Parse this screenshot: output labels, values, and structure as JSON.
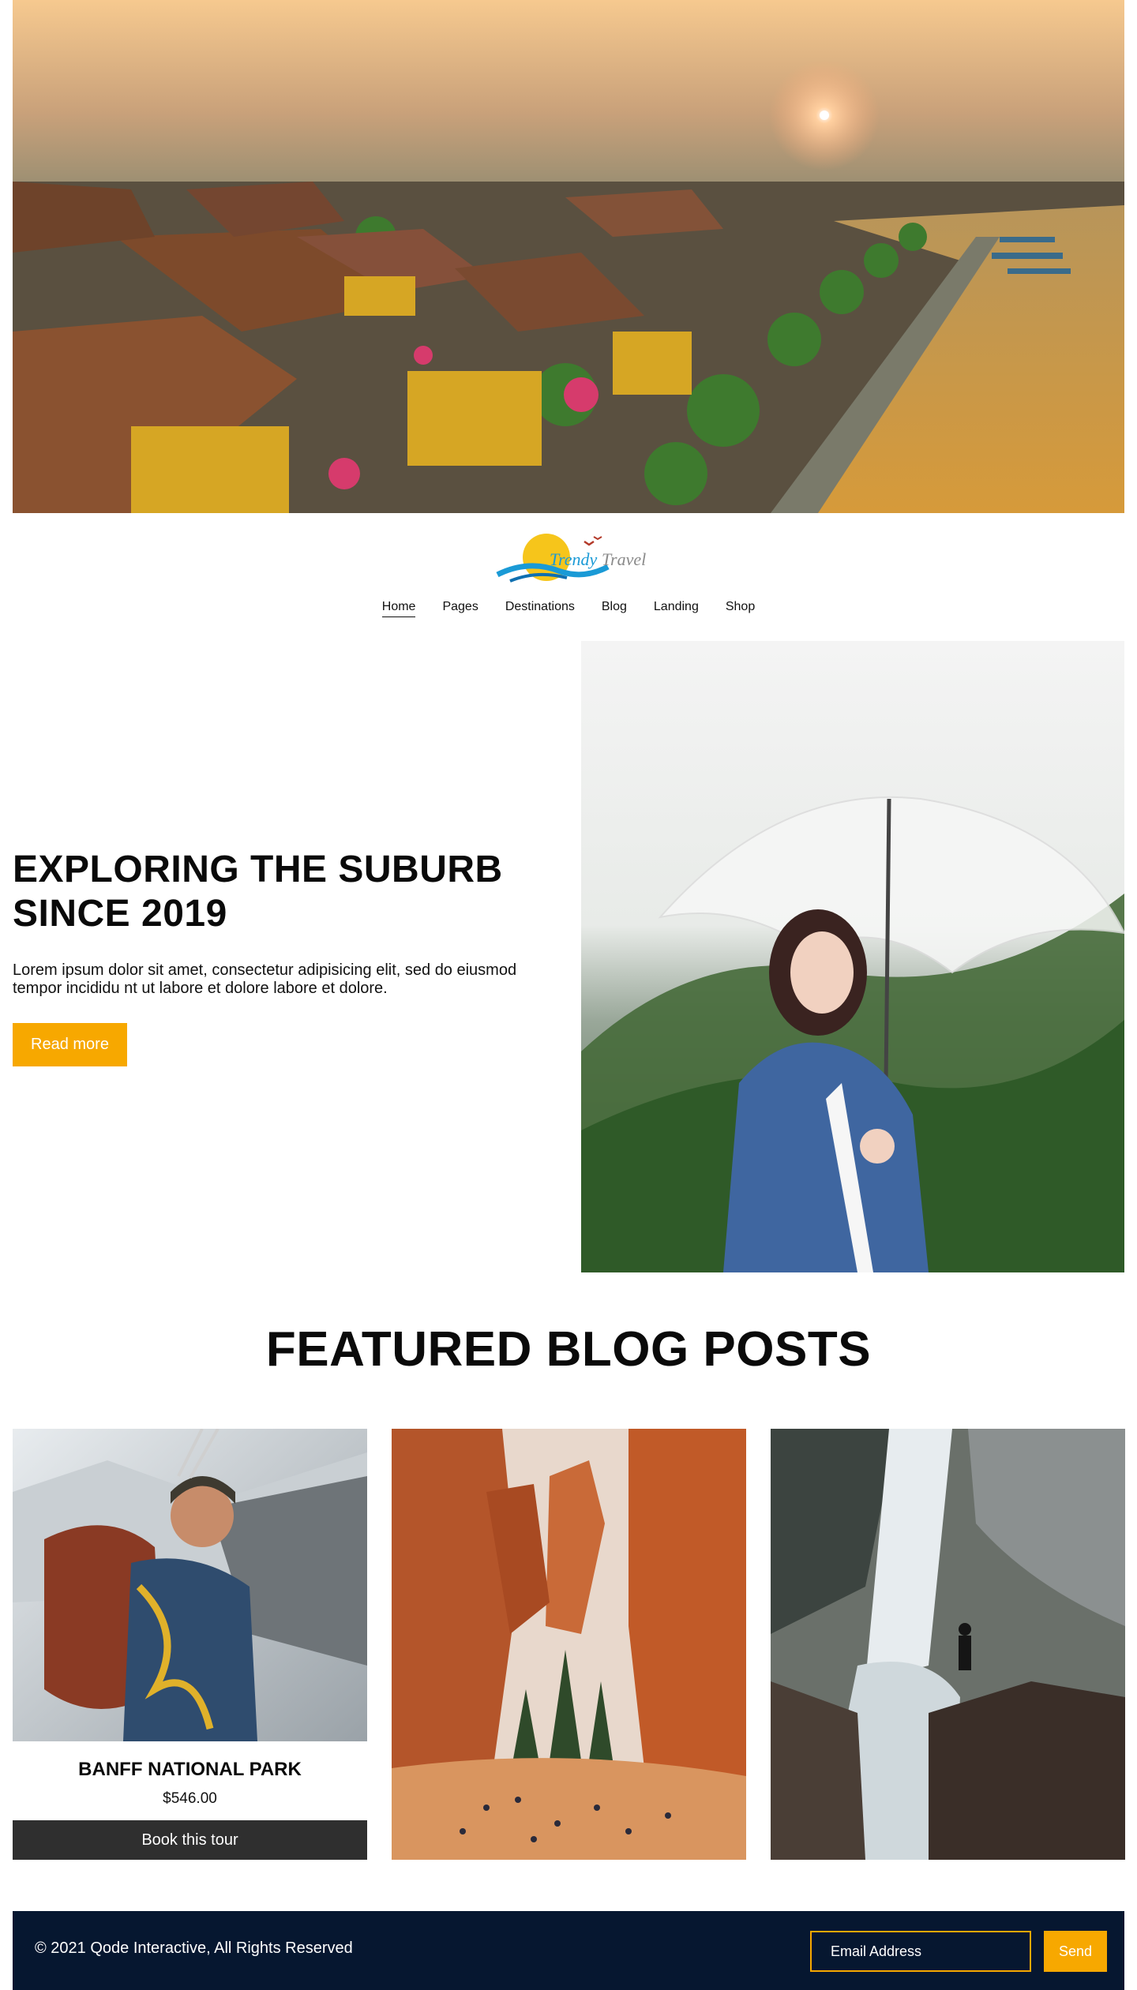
{
  "brand": {
    "logo_text_a": "Trendy",
    "logo_text_b": "Travel"
  },
  "nav": {
    "items": [
      {
        "label": "Home",
        "active": true
      },
      {
        "label": "Pages"
      },
      {
        "label": "Destinations"
      },
      {
        "label": "Blog"
      },
      {
        "label": "Landing"
      },
      {
        "label": "Shop"
      }
    ]
  },
  "intro": {
    "title_line1": "EXPLORING THE SUBURB",
    "title_line2": "SINCE 2019",
    "body": "Lorem ipsum dolor sit amet, consectetur adipisicing elit, sed do eiusmod tempor incididu nt ut labore et dolore labore et dolore.",
    "button": "Read more"
  },
  "featured": {
    "title": "FEATURED BLOG POSTS",
    "cards": [
      {
        "name": "BANFF NATIONAL PARK",
        "price": "$546.00",
        "button": "Book this tour"
      }
    ]
  },
  "footer": {
    "copyright": "© 2021 Qode Interactive, All Rights Reserved",
    "email_placeholder": "Email Address",
    "send": "Send"
  },
  "colors": {
    "accent": "#f7a800",
    "footer_bg": "#061730",
    "dark_button": "#2f2f2f"
  }
}
